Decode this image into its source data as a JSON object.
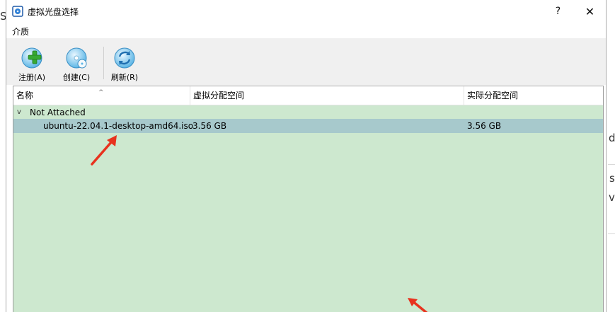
{
  "background": {
    "fragments": [
      "S",
      "d",
      "s",
      "v"
    ]
  },
  "window": {
    "title": "虚拟光盘选择",
    "help_label": "?",
    "close_label": "✕"
  },
  "menu": {
    "items": [
      {
        "label": "介质"
      }
    ]
  },
  "toolbar": {
    "register_label": "注册(A)",
    "create_label": "创建(C)",
    "refresh_label": "刷新(R)"
  },
  "table": {
    "columns": [
      "名称",
      "虚拟分配空间",
      "实际分配空间"
    ],
    "sort_indicator": "^",
    "groups": [
      {
        "label": "Not Attached",
        "expander": "v",
        "items": [
          {
            "name": "ubuntu-22.04.1-desktop-amd64.iso",
            "virtual_size": "3.56 GB",
            "actual_size": "3.56 GB"
          }
        ]
      }
    ]
  },
  "colors": {
    "list_background": "#cde8cf",
    "selected_row": "#a7c9cc",
    "toolbar_background": "#f0f0f0",
    "annotation_arrow": "#e8321e"
  }
}
